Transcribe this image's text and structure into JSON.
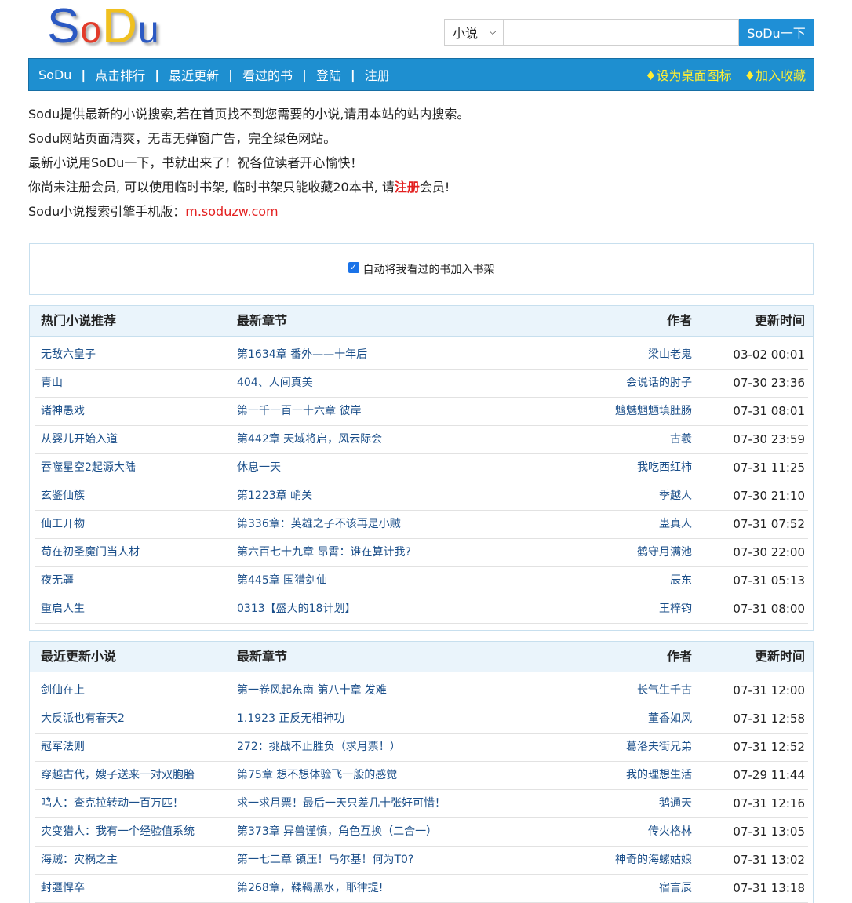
{
  "logo": {
    "l1": "S",
    "l2": "o",
    "l3": "D",
    "l4": "u"
  },
  "search": {
    "select_value": "小说",
    "input_value": "",
    "button_label": "SoDu一下"
  },
  "nav": {
    "items": [
      "SoDu",
      "点击排行",
      "最近更新",
      "看过的书",
      "登陆",
      "注册"
    ],
    "sep": "|",
    "desktop_icon": "♦设为桌面图标",
    "favorite": "♦加入收藏"
  },
  "intro": {
    "line1": "Sodu提供最新的小说搜索,若在首页找不到您需要的小说,请用本站的站内搜索。",
    "line2": "Sodu网站页面清爽，无毒无弹窗广告，完全绿色网站。",
    "line3": "最新小说用SoDu一下，书就出来了！祝各位读者开心愉快！",
    "line4_pre": "你尚未注册会员, 可以使用临时书架, 临时书架只能收藏20本书, 请",
    "line4_link": "注册",
    "line4_post": "会员!",
    "line5_pre": "Sodu小说搜索引擎手机版：",
    "line5_link": "m.soduzw.com"
  },
  "autobox": {
    "label": "自动将我看过的书加入书架",
    "checked": true
  },
  "hot": {
    "headers": [
      "热门小说推荐",
      "最新章节",
      "作者",
      "更新时间"
    ],
    "rows": [
      [
        "无敌六皇子",
        "第1634章 番外——十年后",
        "梁山老鬼",
        "03-02 00:01"
      ],
      [
        "青山",
        "404、人间真美",
        "会说话的肘子",
        "07-30 23:36"
      ],
      [
        "诸神愚戏",
        "第一千一百一十六章 彼岸",
        "魑魅魍魉填肚肠",
        "07-31 08:01"
      ],
      [
        "从婴儿开始入道",
        "第442章 天域将启，风云际会",
        "古羲",
        "07-30 23:59"
      ],
      [
        "吞噬星空2起源大陆",
        "休息一天",
        "我吃西红柿",
        "07-31 11:25"
      ],
      [
        "玄鉴仙族",
        "第1223章 峭关",
        "季越人",
        "07-30 21:10"
      ],
      [
        "仙工开物",
        "第336章：英雄之子不该再是小贼",
        "蛊真人",
        "07-31 07:52"
      ],
      [
        "苟在初圣魔门当人材",
        "第六百七十九章 昂霄：谁在算计我?",
        "鹤守月满池",
        "07-30 22:00"
      ],
      [
        "夜无疆",
        "第445章 围猎剑仙",
        "辰东",
        "07-31 05:13"
      ],
      [
        "重启人生",
        "0313【盛大的18计划】",
        "王梓钧",
        "07-31 08:00"
      ]
    ]
  },
  "recent": {
    "headers": [
      "最近更新小说",
      "最新章节",
      "作者",
      "更新时间"
    ],
    "rows": [
      [
        "剑仙在上",
        "第一卷风起东南 第八十章 发难",
        "长气生千古",
        "07-31 12:00"
      ],
      [
        "大反派也有春天2",
        "1.1923 正反无相神功",
        "董香如风",
        "07-31 12:58"
      ],
      [
        "冠军法则",
        "272：挑战不止胜负（求月票！）",
        "葛洛夫街兄弟",
        "07-31 12:52"
      ],
      [
        "穿越古代，嫂子送来一对双胞胎",
        "第75章 想不想体验飞一般的感觉",
        "我的理想生活",
        "07-29 11:44"
      ],
      [
        "鸣人：查克拉转动一百万匹！",
        "求一求月票！最后一天只差几十张好可惜！",
        "鹅通天",
        "07-31 12:16"
      ],
      [
        "灾变猎人：我有一个经验值系统",
        "第373章 异兽谨慎，角色互换（二合一）",
        "传火格林",
        "07-31 13:05"
      ],
      [
        "海贼：灾祸之主",
        "第一七二章 镇压！乌尔基！何为T0?",
        "神奇的海螺姑娘",
        "07-31 13:02"
      ],
      [
        "封疆悍卒",
        "第268章，鞣鞨黑水，耶律提!",
        "宿言辰",
        "07-31 13:18"
      ]
    ]
  }
}
